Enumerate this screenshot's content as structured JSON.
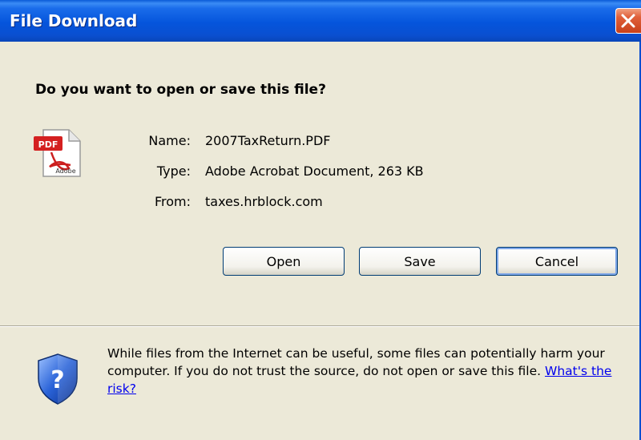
{
  "window": {
    "title": "File Download",
    "close_icon": "close-icon"
  },
  "dialog": {
    "question": "Do you want to open or save this file?",
    "file_icon": "pdf-file-icon",
    "file_icon_text": "PDF",
    "file_icon_brand": "Adobe",
    "fields": {
      "name_label": "Name:",
      "name_value": "2007TaxReturn.PDF",
      "type_label": "Type:",
      "type_value": "Adobe Acrobat Document, 263 KB",
      "from_label": "From:",
      "from_value": "taxes.hrblock.com"
    },
    "buttons": {
      "open": "Open",
      "save": "Save",
      "cancel": "Cancel"
    }
  },
  "warning": {
    "icon": "security-shield-icon",
    "text": "While files from the Internet can be useful, some files can potentially harm your computer. If you do not trust the source, do not open or save this file.",
    "link": "What's the risk?"
  },
  "colors": {
    "titlebar": "#0a4fd0",
    "dialog_bg": "#ece9d8",
    "close_button": "#e0603a",
    "link": "#0000ee"
  }
}
